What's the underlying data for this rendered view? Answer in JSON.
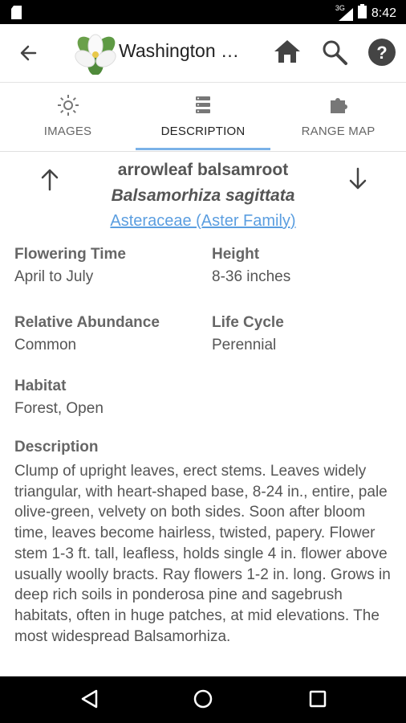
{
  "status_bar": {
    "network": "3G",
    "time": "8:42",
    "icons": [
      "sd-card-icon",
      "signal-icon",
      "battery-icon"
    ]
  },
  "app_bar": {
    "title": "Washington Wildflowers",
    "icons": [
      "back-arrow-icon",
      "trillium-logo-icon",
      "home-icon",
      "search-icon",
      "help-icon"
    ]
  },
  "tabs": [
    {
      "label": "IMAGES",
      "icon": "sun-icon",
      "active": false
    },
    {
      "label": "DESCRIPTION",
      "icon": "list-icon",
      "active": true
    },
    {
      "label": "RANGE MAP",
      "icon": "puzzle-icon",
      "active": false
    }
  ],
  "species": {
    "common_name": "arrowleaf balsamroot",
    "scientific_name": "Balsamorhiza sagittata",
    "family": "Asteraceae (Aster Family)"
  },
  "fields": {
    "flowering_time": {
      "label": "Flowering Time",
      "value": "April to July"
    },
    "height": {
      "label": "Height",
      "value": "8-36 inches"
    },
    "abundance": {
      "label": "Relative Abundance",
      "value": "Common"
    },
    "life_cycle": {
      "label": "Life Cycle",
      "value": "Perennial"
    },
    "habitat": {
      "label": "Habitat",
      "value": "Forest, Open"
    }
  },
  "description": {
    "label": "Description",
    "text": "Clump of upright leaves, erect stems. Leaves widely triangular, with heart-shaped base, 8-24 in., entire, pale olive-green, velvety on both sides. Soon after bloom time, leaves become hairless, twisted, papery. Flower stem 1-3 ft. tall, leafless, holds single 4 in. flower above usually woolly bracts. Ray flowers 1-2 in. long. Grows in deep rich soils in ponderosa pine and sagebrush habitats, often in huge patches, at mid elevations. The most widespread Balsamorhiza."
  },
  "colors": {
    "accent": "#7ab2e8",
    "link": "#5b9ee0",
    "bar": "#000000"
  },
  "nav_bar": {
    "icons": [
      "back-triangle-icon",
      "home-circle-icon",
      "recents-square-icon"
    ]
  }
}
